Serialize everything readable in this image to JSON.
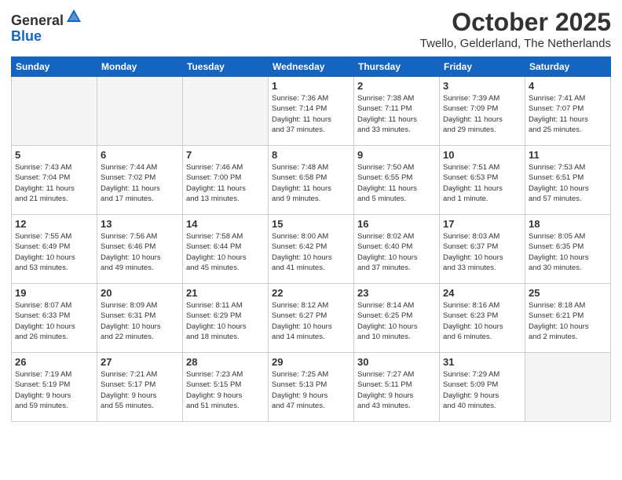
{
  "header": {
    "logo_general": "General",
    "logo_blue": "Blue",
    "title": "October 2025",
    "subtitle": "Twello, Gelderland, The Netherlands"
  },
  "columns": [
    "Sunday",
    "Monday",
    "Tuesday",
    "Wednesday",
    "Thursday",
    "Friday",
    "Saturday"
  ],
  "weeks": [
    [
      {
        "day": "",
        "info": ""
      },
      {
        "day": "",
        "info": ""
      },
      {
        "day": "",
        "info": ""
      },
      {
        "day": "1",
        "info": "Sunrise: 7:36 AM\nSunset: 7:14 PM\nDaylight: 11 hours\nand 37 minutes."
      },
      {
        "day": "2",
        "info": "Sunrise: 7:38 AM\nSunset: 7:11 PM\nDaylight: 11 hours\nand 33 minutes."
      },
      {
        "day": "3",
        "info": "Sunrise: 7:39 AM\nSunset: 7:09 PM\nDaylight: 11 hours\nand 29 minutes."
      },
      {
        "day": "4",
        "info": "Sunrise: 7:41 AM\nSunset: 7:07 PM\nDaylight: 11 hours\nand 25 minutes."
      }
    ],
    [
      {
        "day": "5",
        "info": "Sunrise: 7:43 AM\nSunset: 7:04 PM\nDaylight: 11 hours\nand 21 minutes."
      },
      {
        "day": "6",
        "info": "Sunrise: 7:44 AM\nSunset: 7:02 PM\nDaylight: 11 hours\nand 17 minutes."
      },
      {
        "day": "7",
        "info": "Sunrise: 7:46 AM\nSunset: 7:00 PM\nDaylight: 11 hours\nand 13 minutes."
      },
      {
        "day": "8",
        "info": "Sunrise: 7:48 AM\nSunset: 6:58 PM\nDaylight: 11 hours\nand 9 minutes."
      },
      {
        "day": "9",
        "info": "Sunrise: 7:50 AM\nSunset: 6:55 PM\nDaylight: 11 hours\nand 5 minutes."
      },
      {
        "day": "10",
        "info": "Sunrise: 7:51 AM\nSunset: 6:53 PM\nDaylight: 11 hours\nand 1 minute."
      },
      {
        "day": "11",
        "info": "Sunrise: 7:53 AM\nSunset: 6:51 PM\nDaylight: 10 hours\nand 57 minutes."
      }
    ],
    [
      {
        "day": "12",
        "info": "Sunrise: 7:55 AM\nSunset: 6:49 PM\nDaylight: 10 hours\nand 53 minutes."
      },
      {
        "day": "13",
        "info": "Sunrise: 7:56 AM\nSunset: 6:46 PM\nDaylight: 10 hours\nand 49 minutes."
      },
      {
        "day": "14",
        "info": "Sunrise: 7:58 AM\nSunset: 6:44 PM\nDaylight: 10 hours\nand 45 minutes."
      },
      {
        "day": "15",
        "info": "Sunrise: 8:00 AM\nSunset: 6:42 PM\nDaylight: 10 hours\nand 41 minutes."
      },
      {
        "day": "16",
        "info": "Sunrise: 8:02 AM\nSunset: 6:40 PM\nDaylight: 10 hours\nand 37 minutes."
      },
      {
        "day": "17",
        "info": "Sunrise: 8:03 AM\nSunset: 6:37 PM\nDaylight: 10 hours\nand 33 minutes."
      },
      {
        "day": "18",
        "info": "Sunrise: 8:05 AM\nSunset: 6:35 PM\nDaylight: 10 hours\nand 30 minutes."
      }
    ],
    [
      {
        "day": "19",
        "info": "Sunrise: 8:07 AM\nSunset: 6:33 PM\nDaylight: 10 hours\nand 26 minutes."
      },
      {
        "day": "20",
        "info": "Sunrise: 8:09 AM\nSunset: 6:31 PM\nDaylight: 10 hours\nand 22 minutes."
      },
      {
        "day": "21",
        "info": "Sunrise: 8:11 AM\nSunset: 6:29 PM\nDaylight: 10 hours\nand 18 minutes."
      },
      {
        "day": "22",
        "info": "Sunrise: 8:12 AM\nSunset: 6:27 PM\nDaylight: 10 hours\nand 14 minutes."
      },
      {
        "day": "23",
        "info": "Sunrise: 8:14 AM\nSunset: 6:25 PM\nDaylight: 10 hours\nand 10 minutes."
      },
      {
        "day": "24",
        "info": "Sunrise: 8:16 AM\nSunset: 6:23 PM\nDaylight: 10 hours\nand 6 minutes."
      },
      {
        "day": "25",
        "info": "Sunrise: 8:18 AM\nSunset: 6:21 PM\nDaylight: 10 hours\nand 2 minutes."
      }
    ],
    [
      {
        "day": "26",
        "info": "Sunrise: 7:19 AM\nSunset: 5:19 PM\nDaylight: 9 hours\nand 59 minutes."
      },
      {
        "day": "27",
        "info": "Sunrise: 7:21 AM\nSunset: 5:17 PM\nDaylight: 9 hours\nand 55 minutes."
      },
      {
        "day": "28",
        "info": "Sunrise: 7:23 AM\nSunset: 5:15 PM\nDaylight: 9 hours\nand 51 minutes."
      },
      {
        "day": "29",
        "info": "Sunrise: 7:25 AM\nSunset: 5:13 PM\nDaylight: 9 hours\nand 47 minutes."
      },
      {
        "day": "30",
        "info": "Sunrise: 7:27 AM\nSunset: 5:11 PM\nDaylight: 9 hours\nand 43 minutes."
      },
      {
        "day": "31",
        "info": "Sunrise: 7:29 AM\nSunset: 5:09 PM\nDaylight: 9 hours\nand 40 minutes."
      },
      {
        "day": "",
        "info": ""
      }
    ]
  ]
}
